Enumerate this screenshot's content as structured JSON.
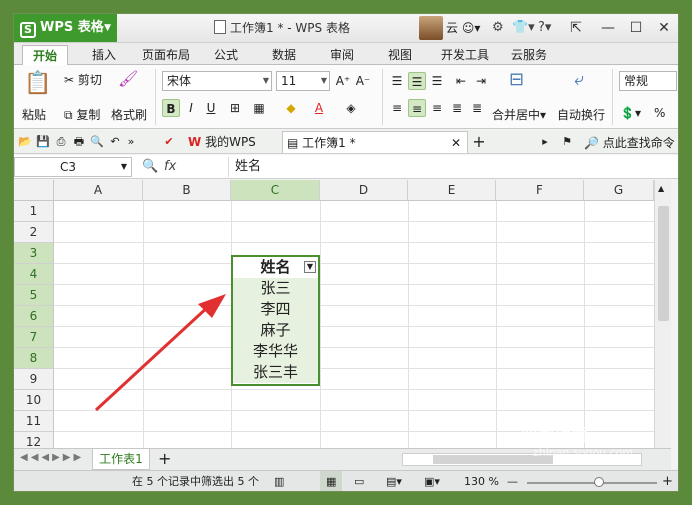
{
  "titlebar": {
    "app_name": "WPS 表格",
    "document_title": "工作簿1 * - WPS 表格",
    "user": "云",
    "question": "?"
  },
  "ribbon_tabs": [
    "开始",
    "插入",
    "页面布局",
    "公式",
    "数据",
    "审阅",
    "视图",
    "开发工具",
    "云服务"
  ],
  "active_tab": "开始",
  "ribbon": {
    "paste": "粘贴",
    "cut": "剪切",
    "copy": "复制",
    "format_painter": "格式刷",
    "font_name": "宋体",
    "font_size": "11",
    "merge_center": "合并居中",
    "auto_wrap": "自动换行",
    "number_format": "常规",
    "percent": "%"
  },
  "quick_access": {
    "doc_tab_mywps": "我的WPS",
    "doc_tab_active": "工作簿1 *",
    "search_commands": "点此查找命令"
  },
  "formula_bar": {
    "name_box": "C3",
    "fx": "fx",
    "content": "姓名"
  },
  "grid": {
    "columns": [
      "A",
      "B",
      "C",
      "D",
      "E",
      "F",
      "G"
    ],
    "rows": [
      "1",
      "2",
      "3",
      "4",
      "5",
      "6",
      "7",
      "8",
      "9",
      "10",
      "11",
      "12"
    ],
    "selected_column": "C",
    "cells": {
      "C3": "姓名",
      "C4": "张三",
      "C5": "李四",
      "C6": "麻子",
      "C7": "李华华",
      "C8": "张三丰"
    }
  },
  "sheet_tabs": [
    "工作表1"
  ],
  "status_bar": {
    "filter_message": "在 5 个记录中筛选出 5 个",
    "zoom": "130 %"
  },
  "watermark": {
    "line1": "搜狗指南",
    "line2": "zhinan.sogou.com"
  },
  "colors": {
    "accent": "#3f9a2e",
    "selection_border": "#4a8f2f",
    "arrow": "#e03030"
  }
}
